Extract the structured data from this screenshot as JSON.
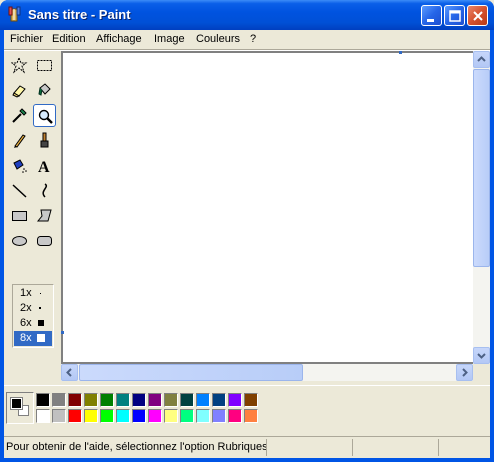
{
  "window": {
    "title": "Sans titre - Paint"
  },
  "menu": [
    "Fichier",
    "Edition",
    "Affichage",
    "Image",
    "Couleurs",
    "?"
  ],
  "tools": [
    {
      "name": "free-select-tool",
      "icon": "star-select-icon"
    },
    {
      "name": "rect-select-tool",
      "icon": "rect-select-icon"
    },
    {
      "name": "eraser-tool",
      "icon": "eraser-icon"
    },
    {
      "name": "fill-tool",
      "icon": "paint-bucket-icon"
    },
    {
      "name": "color-picker-tool",
      "icon": "eyedropper-icon"
    },
    {
      "name": "magnifier-tool",
      "icon": "magnifier-icon",
      "active": true
    },
    {
      "name": "pencil-tool",
      "icon": "pencil-icon"
    },
    {
      "name": "brush-tool",
      "icon": "brush-icon"
    },
    {
      "name": "airbrush-tool",
      "icon": "airbrush-icon"
    },
    {
      "name": "text-tool",
      "icon": "text-a-icon"
    },
    {
      "name": "line-tool",
      "icon": "line-icon"
    },
    {
      "name": "curve-tool",
      "icon": "curve-icon"
    },
    {
      "name": "rectangle-tool",
      "icon": "rectangle-icon"
    },
    {
      "name": "polygon-tool",
      "icon": "polygon-icon"
    },
    {
      "name": "ellipse-tool",
      "icon": "ellipse-icon"
    },
    {
      "name": "rounded-rect-tool",
      "icon": "rounded-rect-icon"
    }
  ],
  "zoom_options": [
    "1x",
    "2x",
    "6x",
    "8x"
  ],
  "zoom_selected": "8x",
  "palette": {
    "top": [
      "#000000",
      "#808080",
      "#800000",
      "#808000",
      "#008000",
      "#008080",
      "#000080",
      "#800080",
      "#808040",
      "#004040",
      "#0080ff",
      "#004080",
      "#8000ff",
      "#804000"
    ],
    "bottom": [
      "#ffffff",
      "#c0c0c0",
      "#ff0000",
      "#ffff00",
      "#00ff00",
      "#00ffff",
      "#0000ff",
      "#ff00ff",
      "#ffff80",
      "#00ff80",
      "#80ffff",
      "#8080ff",
      "#ff0080",
      "#ff8040"
    ]
  },
  "current_colors": {
    "foreground": "#000000",
    "background": "#ffffff"
  },
  "status": {
    "text": "Pour obtenir de l'aide, sélectionnez l'option Rubriques d"
  }
}
